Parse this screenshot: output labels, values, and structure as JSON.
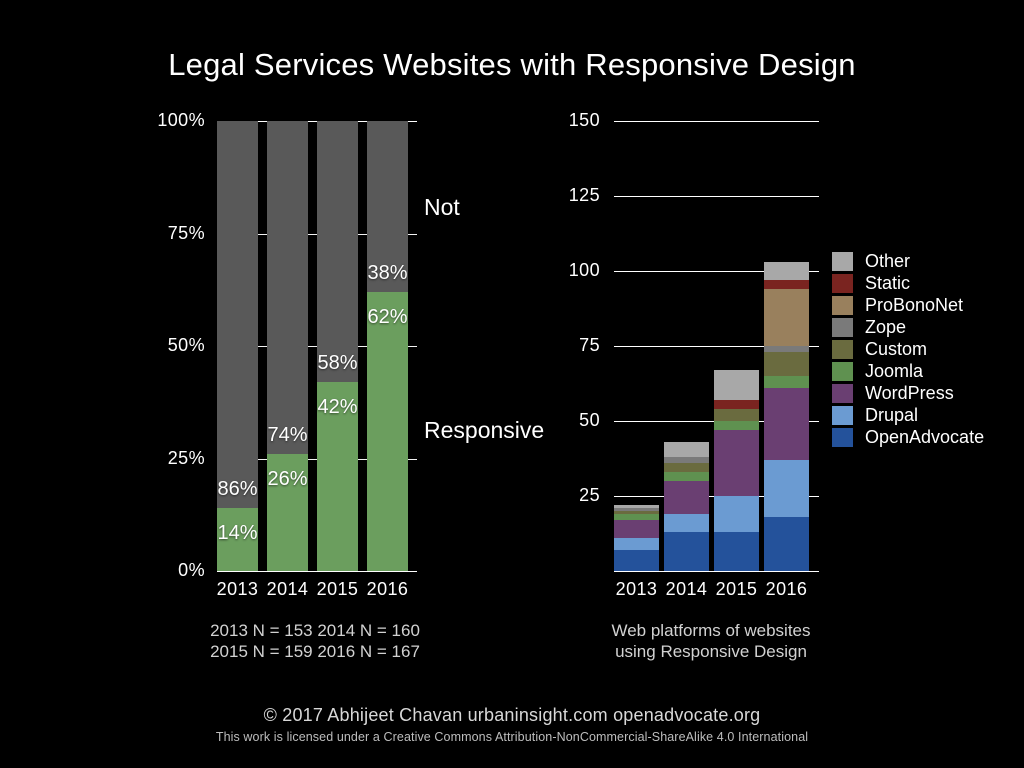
{
  "title": "Legal Services Websites with Responsive Design",
  "footer": {
    "line1": "© 2017  Abhijeet Chavan  urbaninsight.com  openadvocate.org",
    "line2": "This work is licensed under a Creative Commons Attribution-NonCommercial-ShareAlike 4.0 International"
  },
  "left": {
    "caption": "2013 N = 153    2014 N = 160\n2015 N = 159    2016 N = 167",
    "series_labels": {
      "not": "Not",
      "responsive": "Responsive"
    }
  },
  "right": {
    "caption": "Web platforms of websites\nusing Responsive Design"
  },
  "chart_data": [
    {
      "id": "responsive-share",
      "type": "bar",
      "stacked": true,
      "normalized": true,
      "title": "Legal Services Websites with Responsive Design",
      "xlabel": "",
      "ylabel": "",
      "ylim": [
        0,
        100
      ],
      "yticks": [
        0,
        25,
        50,
        75,
        100
      ],
      "ytick_labels": [
        "0%",
        "25%",
        "50%",
        "75%",
        "100%"
      ],
      "grid": true,
      "categories": [
        "2013",
        "2014",
        "2015",
        "2016"
      ],
      "sample_sizes": [
        153,
        160,
        159,
        167
      ],
      "series": [
        {
          "name": "Responsive",
          "color": "#6b9e5e",
          "values": [
            14,
            26,
            42,
            62
          ],
          "labels": [
            "14%",
            "26%",
            "42%",
            "62%"
          ]
        },
        {
          "name": "Not",
          "color": "#595959",
          "values": [
            86,
            74,
            58,
            38
          ],
          "labels": [
            "86%",
            "74%",
            "58%",
            "38%"
          ]
        }
      ]
    },
    {
      "id": "web-platforms",
      "type": "bar",
      "stacked": true,
      "normalized": false,
      "title": "Web platforms of websites using Responsive Design",
      "xlabel": "",
      "ylabel": "",
      "ylim": [
        0,
        150
      ],
      "yticks": [
        25,
        50,
        75,
        100,
        125,
        150
      ],
      "ytick_labels": [
        "25",
        "50",
        "75",
        "100",
        "125",
        "150"
      ],
      "grid": true,
      "legend_position": "right",
      "categories": [
        "2013",
        "2014",
        "2015",
        "2016"
      ],
      "totals": [
        22,
        43,
        67,
        103
      ],
      "series": [
        {
          "name": "OpenAdvocate",
          "color": "#24529b",
          "values": [
            7,
            13,
            13,
            18
          ]
        },
        {
          "name": "Drupal",
          "color": "#6b9bd2",
          "values": [
            4,
            6,
            12,
            19
          ]
        },
        {
          "name": "WordPress",
          "color": "#6a3f72",
          "values": [
            6,
            11,
            22,
            24
          ]
        },
        {
          "name": "Joomla",
          "color": "#5f9150",
          "values": [
            2,
            3,
            3,
            4
          ]
        },
        {
          "name": "Custom",
          "color": "#6a6b3f",
          "values": [
            1,
            3,
            4,
            8
          ]
        },
        {
          "name": "Zope",
          "color": "#7a7a7a",
          "values": [
            1,
            2,
            0,
            2
          ]
        },
        {
          "name": "ProBonoNet",
          "color": "#99805d",
          "values": [
            0,
            0,
            0,
            19
          ]
        },
        {
          "name": "Static",
          "color": "#7a2420",
          "values": [
            0,
            0,
            3,
            3
          ]
        },
        {
          "name": "Other",
          "color": "#a8a8a8",
          "values": [
            1,
            5,
            10,
            6
          ]
        }
      ],
      "legend_order": [
        "Other",
        "Static",
        "ProBonoNet",
        "Zope",
        "Custom",
        "Joomla",
        "WordPress",
        "Drupal",
        "OpenAdvocate"
      ]
    }
  ]
}
